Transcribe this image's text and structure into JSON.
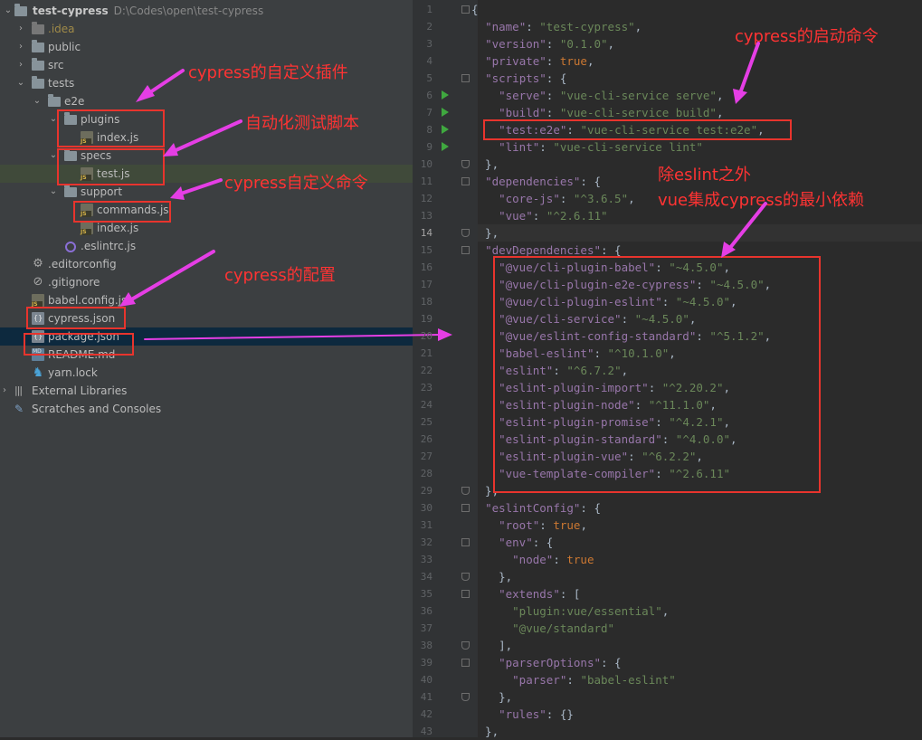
{
  "project": {
    "root_name": "test-cypress",
    "root_path": "D:\\Codes\\open\\test-cypress",
    "items": [
      {
        "label": "idea_folder",
        "text": ".idea"
      },
      {
        "label": "public_folder",
        "text": "public"
      },
      {
        "label": "src_folder",
        "text": "src"
      },
      {
        "label": "tests_folder",
        "text": "tests"
      },
      {
        "label": "e2e_folder",
        "text": "e2e"
      },
      {
        "label": "plugins_folder",
        "text": "plugins"
      },
      {
        "label": "plugins_index",
        "text": "index.js"
      },
      {
        "label": "specs_folder",
        "text": "specs"
      },
      {
        "label": "specs_test",
        "text": "test.js"
      },
      {
        "label": "support_folder",
        "text": "support"
      },
      {
        "label": "support_commands",
        "text": "commands.js"
      },
      {
        "label": "support_index",
        "text": "index.js"
      },
      {
        "label": "eslintrc",
        "text": ".eslintrc.js"
      },
      {
        "label": "editorconfig",
        "text": ".editorconfig"
      },
      {
        "label": "gitignore",
        "text": ".gitignore"
      },
      {
        "label": "babel_config",
        "text": "babel.config.js"
      },
      {
        "label": "cypress_json",
        "text": "cypress.json"
      },
      {
        "label": "package_json",
        "text": "package.json"
      },
      {
        "label": "readme",
        "text": "README.md"
      },
      {
        "label": "yarn_lock",
        "text": "yarn.lock"
      },
      {
        "label": "external_libraries",
        "text": "External Libraries"
      },
      {
        "label": "scratches",
        "text": "Scratches and Consoles"
      }
    ]
  },
  "editor": {
    "current_line": 14,
    "lines": [
      "{",
      "  \"name\": \"test-cypress\",",
      "  \"version\": \"0.1.0\",",
      "  \"private\": true,",
      "  \"scripts\": {",
      "    \"serve\": \"vue-cli-service serve\",",
      "    \"build\": \"vue-cli-service build\",",
      "    \"test:e2e\": \"vue-cli-service test:e2e\",",
      "    \"lint\": \"vue-cli-service lint\"",
      "  },",
      "  \"dependencies\": {",
      "    \"core-js\": \"^3.6.5\",",
      "    \"vue\": \"^2.6.11\"",
      "  },",
      "  \"devDependencies\": {",
      "    \"@vue/cli-plugin-babel\": \"~4.5.0\",",
      "    \"@vue/cli-plugin-e2e-cypress\": \"~4.5.0\",",
      "    \"@vue/cli-plugin-eslint\": \"~4.5.0\",",
      "    \"@vue/cli-service\": \"~4.5.0\",",
      "    \"@vue/eslint-config-standard\": \"^5.1.2\",",
      "    \"babel-eslint\": \"^10.1.0\",",
      "    \"eslint\": \"^6.7.2\",",
      "    \"eslint-plugin-import\": \"^2.20.2\",",
      "    \"eslint-plugin-node\": \"^11.1.0\",",
      "    \"eslint-plugin-promise\": \"^4.2.1\",",
      "    \"eslint-plugin-standard\": \"^4.0.0\",",
      "    \"eslint-plugin-vue\": \"^6.2.2\",",
      "    \"vue-template-compiler\": \"^2.6.11\"",
      "  },",
      "  \"eslintConfig\": {",
      "    \"root\": true,",
      "    \"env\": {",
      "      \"node\": true",
      "    },",
      "    \"extends\": [",
      "      \"plugin:vue/essential\",",
      "      \"@vue/standard\"",
      "    ],",
      "    \"parserOptions\": {",
      "      \"parser\": \"babel-eslint\"",
      "    },",
      "    \"rules\": {}",
      "  },"
    ],
    "line_numbers": [
      "1",
      "2",
      "3",
      "4",
      "5",
      "6",
      "7",
      "8",
      "9",
      "10",
      "11",
      "12",
      "13",
      "14",
      "15",
      "16",
      "17",
      "18",
      "19",
      "20",
      "21",
      "22",
      "23",
      "24",
      "25",
      "26",
      "27",
      "28",
      "29",
      "30",
      "31",
      "32",
      "33",
      "34",
      "35",
      "36",
      "37",
      "38",
      "39",
      "40",
      "41",
      "42",
      "43"
    ]
  },
  "annotations": {
    "plugins_note": "cypress的自定义插件",
    "specs_note": "自动化测试脚本",
    "commands_note": "cypress自定义命令",
    "config_note": "cypress的配置",
    "start_note": "cypress的启动命令",
    "deps_note_1": "除eslint之外",
    "deps_note_2": "vue集成cypress的最小依赖",
    "color": "#ff3333",
    "arrow_color": "#e53ee5"
  }
}
